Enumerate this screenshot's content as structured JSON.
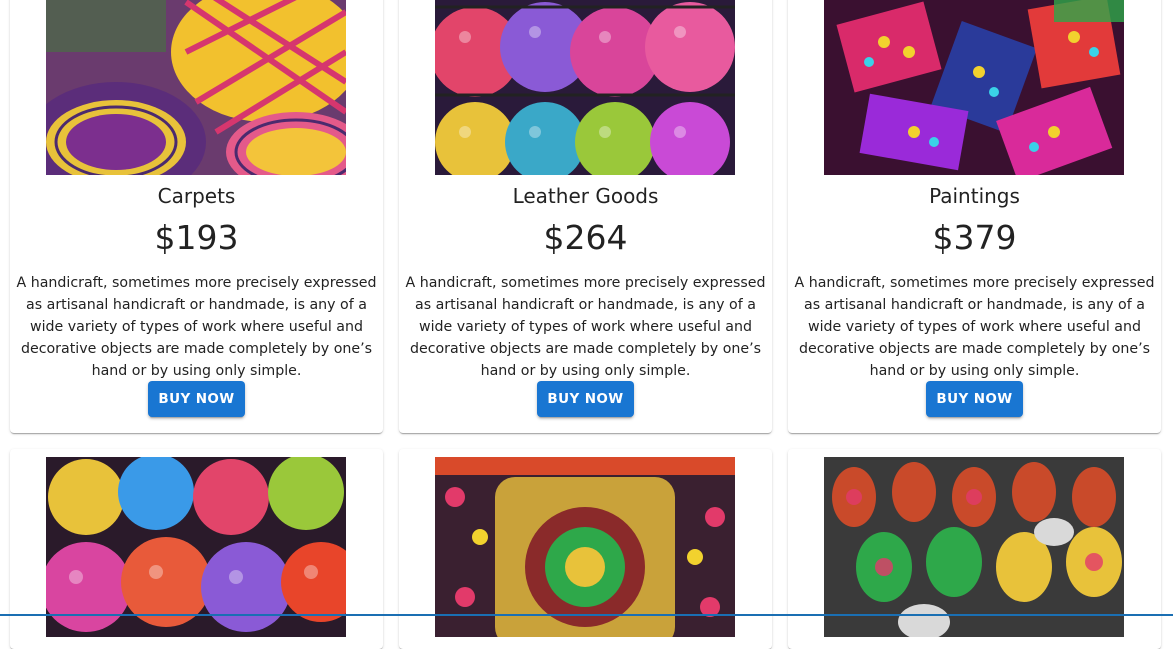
{
  "products": [
    {
      "title": "Carpets",
      "price": "$193",
      "description": "A handicraft, sometimes more precisely expressed as artisanal handicraft or handmade, is any of a wide variety of types of work where useful and decorative objects are made completely by one’s hand or by using only simple.",
      "button": "BUY NOW",
      "image_icon": "woven-basket-image"
    },
    {
      "title": "Leather Goods",
      "price": "$264",
      "description": "A handicraft, sometimes more precisely expressed as artisanal handicraft or handmade, is any of a wide variety of types of work where useful and decorative objects are made completely by one’s hand or by using only simple.",
      "button": "BUY NOW",
      "image_icon": "mosaic-lanterns-image"
    },
    {
      "title": "Paintings",
      "price": "$379",
      "description": "A handicraft, sometimes more precisely expressed as artisanal handicraft or handmade, is any of a wide variety of types of work where useful and decorative objects are made completely by one’s hand or by using only simple.",
      "button": "BUY NOW",
      "image_icon": "embroidered-bags-image"
    }
  ],
  "next_row": [
    {
      "image_icon": "mosaic-lanterns-image"
    },
    {
      "image_icon": "embroidered-bag-image"
    },
    {
      "image_icon": "painted-pots-image"
    }
  ],
  "colors": {
    "button": "#1976d2",
    "accent_bar": "#1a6fb3"
  }
}
